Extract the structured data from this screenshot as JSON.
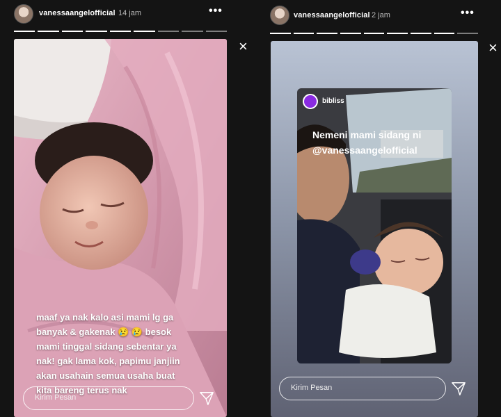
{
  "left": {
    "username": "vanessaangelofficial",
    "time": "14 jam",
    "more_icon": "more-dots-icon",
    "close": "×",
    "caption": [
      "maaf ya nak kalo asi mami lg ga",
      "banyak & gakenak 😢 😢  besok",
      "mami tinggal sidang sebentar ya",
      "nak! gak lama kok, papimu janjiin",
      "akan usahain semua usaha buat",
      "kita bareng terus nak"
    ],
    "message_placeholder": "Kirim Pesan",
    "send_icon": "send-paper-plane-icon",
    "segments": 9,
    "segments_done": 6
  },
  "right": {
    "username": "vanessaangelofficial",
    "time": "2 jam",
    "more_icon": "more-dots-icon",
    "close": "×",
    "quoted": {
      "username": "bibliss",
      "caption": [
        "Nemeni mami sidang ni",
        "@vanessaangelofficial"
      ]
    },
    "message_placeholder": "Kirim Pesan",
    "send_icon": "send-paper-plane-icon",
    "segments": 9,
    "segments_done": 8
  },
  "colors": {
    "background": "#141414",
    "blanket_pink": "#d49aae",
    "right_gradient_top": "#b9c3d4",
    "right_gradient_bottom": "#5f6273"
  }
}
